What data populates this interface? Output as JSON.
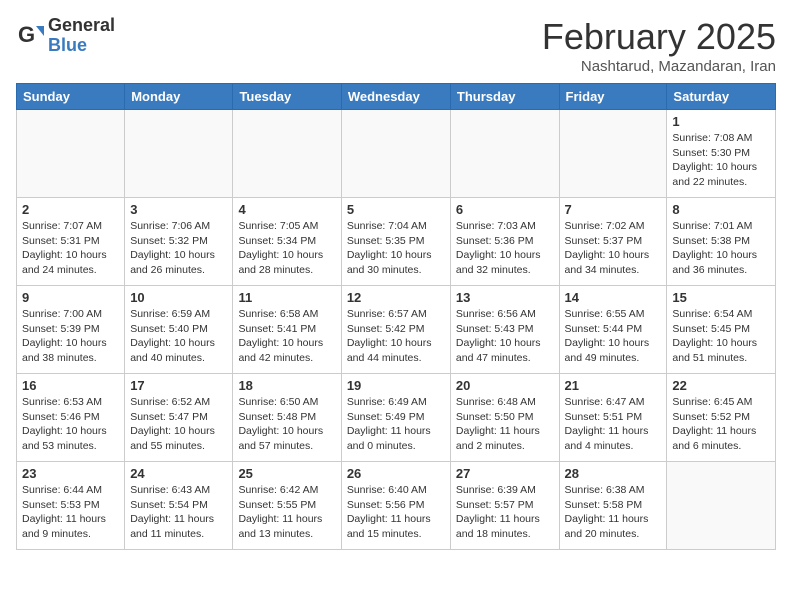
{
  "header": {
    "logo_general": "General",
    "logo_blue": "Blue",
    "month_title": "February 2025",
    "subtitle": "Nashtarud, Mazandaran, Iran"
  },
  "weekdays": [
    "Sunday",
    "Monday",
    "Tuesday",
    "Wednesday",
    "Thursday",
    "Friday",
    "Saturday"
  ],
  "weeks": [
    [
      {
        "day": "",
        "info": ""
      },
      {
        "day": "",
        "info": ""
      },
      {
        "day": "",
        "info": ""
      },
      {
        "day": "",
        "info": ""
      },
      {
        "day": "",
        "info": ""
      },
      {
        "day": "",
        "info": ""
      },
      {
        "day": "1",
        "info": "Sunrise: 7:08 AM\nSunset: 5:30 PM\nDaylight: 10 hours\nand 22 minutes."
      }
    ],
    [
      {
        "day": "2",
        "info": "Sunrise: 7:07 AM\nSunset: 5:31 PM\nDaylight: 10 hours\nand 24 minutes."
      },
      {
        "day": "3",
        "info": "Sunrise: 7:06 AM\nSunset: 5:32 PM\nDaylight: 10 hours\nand 26 minutes."
      },
      {
        "day": "4",
        "info": "Sunrise: 7:05 AM\nSunset: 5:34 PM\nDaylight: 10 hours\nand 28 minutes."
      },
      {
        "day": "5",
        "info": "Sunrise: 7:04 AM\nSunset: 5:35 PM\nDaylight: 10 hours\nand 30 minutes."
      },
      {
        "day": "6",
        "info": "Sunrise: 7:03 AM\nSunset: 5:36 PM\nDaylight: 10 hours\nand 32 minutes."
      },
      {
        "day": "7",
        "info": "Sunrise: 7:02 AM\nSunset: 5:37 PM\nDaylight: 10 hours\nand 34 minutes."
      },
      {
        "day": "8",
        "info": "Sunrise: 7:01 AM\nSunset: 5:38 PM\nDaylight: 10 hours\nand 36 minutes."
      }
    ],
    [
      {
        "day": "9",
        "info": "Sunrise: 7:00 AM\nSunset: 5:39 PM\nDaylight: 10 hours\nand 38 minutes."
      },
      {
        "day": "10",
        "info": "Sunrise: 6:59 AM\nSunset: 5:40 PM\nDaylight: 10 hours\nand 40 minutes."
      },
      {
        "day": "11",
        "info": "Sunrise: 6:58 AM\nSunset: 5:41 PM\nDaylight: 10 hours\nand 42 minutes."
      },
      {
        "day": "12",
        "info": "Sunrise: 6:57 AM\nSunset: 5:42 PM\nDaylight: 10 hours\nand 44 minutes."
      },
      {
        "day": "13",
        "info": "Sunrise: 6:56 AM\nSunset: 5:43 PM\nDaylight: 10 hours\nand 47 minutes."
      },
      {
        "day": "14",
        "info": "Sunrise: 6:55 AM\nSunset: 5:44 PM\nDaylight: 10 hours\nand 49 minutes."
      },
      {
        "day": "15",
        "info": "Sunrise: 6:54 AM\nSunset: 5:45 PM\nDaylight: 10 hours\nand 51 minutes."
      }
    ],
    [
      {
        "day": "16",
        "info": "Sunrise: 6:53 AM\nSunset: 5:46 PM\nDaylight: 10 hours\nand 53 minutes."
      },
      {
        "day": "17",
        "info": "Sunrise: 6:52 AM\nSunset: 5:47 PM\nDaylight: 10 hours\nand 55 minutes."
      },
      {
        "day": "18",
        "info": "Sunrise: 6:50 AM\nSunset: 5:48 PM\nDaylight: 10 hours\nand 57 minutes."
      },
      {
        "day": "19",
        "info": "Sunrise: 6:49 AM\nSunset: 5:49 PM\nDaylight: 11 hours\nand 0 minutes."
      },
      {
        "day": "20",
        "info": "Sunrise: 6:48 AM\nSunset: 5:50 PM\nDaylight: 11 hours\nand 2 minutes."
      },
      {
        "day": "21",
        "info": "Sunrise: 6:47 AM\nSunset: 5:51 PM\nDaylight: 11 hours\nand 4 minutes."
      },
      {
        "day": "22",
        "info": "Sunrise: 6:45 AM\nSunset: 5:52 PM\nDaylight: 11 hours\nand 6 minutes."
      }
    ],
    [
      {
        "day": "23",
        "info": "Sunrise: 6:44 AM\nSunset: 5:53 PM\nDaylight: 11 hours\nand 9 minutes."
      },
      {
        "day": "24",
        "info": "Sunrise: 6:43 AM\nSunset: 5:54 PM\nDaylight: 11 hours\nand 11 minutes."
      },
      {
        "day": "25",
        "info": "Sunrise: 6:42 AM\nSunset: 5:55 PM\nDaylight: 11 hours\nand 13 minutes."
      },
      {
        "day": "26",
        "info": "Sunrise: 6:40 AM\nSunset: 5:56 PM\nDaylight: 11 hours\nand 15 minutes."
      },
      {
        "day": "27",
        "info": "Sunrise: 6:39 AM\nSunset: 5:57 PM\nDaylight: 11 hours\nand 18 minutes."
      },
      {
        "day": "28",
        "info": "Sunrise: 6:38 AM\nSunset: 5:58 PM\nDaylight: 11 hours\nand 20 minutes."
      },
      {
        "day": "",
        "info": ""
      }
    ]
  ]
}
